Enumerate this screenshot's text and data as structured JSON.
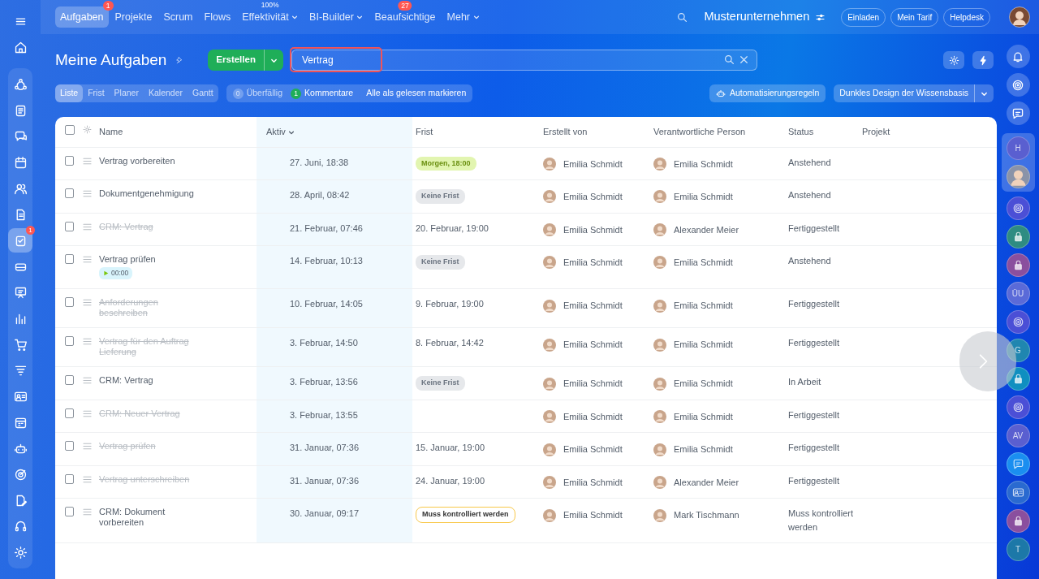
{
  "left_sidebar": {
    "items": [
      {
        "kind": "home",
        "selected": false
      },
      {
        "kind": "flow",
        "selected": false
      },
      {
        "kind": "feed",
        "selected": false
      },
      {
        "kind": "chat",
        "selected": false
      },
      {
        "kind": "calendar",
        "selected": false
      },
      {
        "kind": "people",
        "selected": false
      },
      {
        "kind": "doc",
        "selected": false
      },
      {
        "kind": "tasks",
        "selected": true,
        "badge": "1"
      },
      {
        "kind": "drive",
        "selected": false
      },
      {
        "kind": "board",
        "selected": false
      },
      {
        "kind": "chart",
        "selected": false
      },
      {
        "kind": "cart",
        "selected": false
      },
      {
        "kind": "funnel",
        "selected": false
      },
      {
        "kind": "card",
        "selected": false
      },
      {
        "kind": "planner",
        "selected": false
      },
      {
        "kind": "robot",
        "selected": false
      },
      {
        "kind": "target",
        "selected": false
      },
      {
        "kind": "sign",
        "selected": false
      },
      {
        "kind": "headset",
        "selected": false
      },
      {
        "kind": "settings",
        "selected": false
      }
    ]
  },
  "top_nav": {
    "items": [
      {
        "label": "Aufgaben",
        "selected": true,
        "badge": "1"
      },
      {
        "label": "Projekte",
        "selected": false
      },
      {
        "label": "Scrum",
        "selected": false
      },
      {
        "label": "Flows",
        "selected": false
      },
      {
        "label": "Effektivität",
        "selected": false,
        "caption": "100%",
        "dropdown": true
      },
      {
        "label": "BI-Builder",
        "selected": false,
        "dropdown": true
      },
      {
        "label": "Beaufsichtige",
        "selected": false,
        "badge": "27"
      },
      {
        "label": "Mehr",
        "selected": false,
        "dropdown": true
      }
    ],
    "company": "Musterunternehmen",
    "buttons": [
      "Einladen",
      "Mein Tarif",
      "Helpdesk"
    ]
  },
  "page": {
    "title": "Meine Aufgaben",
    "create_button": "Erstellen",
    "search": {
      "value": "Vertrag",
      "highlighted": true
    }
  },
  "view_tabs": [
    {
      "label": "Liste",
      "selected": true
    },
    {
      "label": "Frist",
      "selected": false
    },
    {
      "label": "Planer",
      "selected": false
    },
    {
      "label": "Kalender",
      "selected": false
    },
    {
      "label": "Gantt",
      "selected": false
    }
  ],
  "counters": [
    {
      "count": "0",
      "label": "Überfällig",
      "active": false
    },
    {
      "count": "1",
      "label": "Kommentare",
      "active": true
    }
  ],
  "mark_all_read": "Alle als gelesen markieren",
  "automation_button": "Automatisierungsregeln",
  "theme_dropdown": "Dunkles Design der Wissensbasis",
  "table": {
    "select_all_checked": false,
    "columns": [
      {
        "label": "Name",
        "sorted": false
      },
      {
        "label": "Aktiv",
        "sorted": true
      },
      {
        "label": "Frist",
        "sorted": false
      },
      {
        "label": "Erstellt von",
        "sorted": false
      },
      {
        "label": "Verantwortliche Person",
        "sorted": false
      },
      {
        "label": "Status",
        "sorted": false
      },
      {
        "label": "Projekt",
        "sorted": false
      }
    ],
    "rows": [
      {
        "checked": false,
        "name": "Vertrag vorbereiten",
        "done": false,
        "active": "27. Juni, 18:38",
        "deadline": {
          "kind": "green",
          "text": "Morgen, 18:00"
        },
        "created_by": "Emilia Schmidt",
        "responsible": "Emilia Schmidt",
        "status": "Anstehend"
      },
      {
        "checked": false,
        "name": "Dokumentgenehmigung",
        "done": false,
        "active": "28. April, 08:42",
        "deadline": {
          "kind": "grey",
          "text": "Keine Frist"
        },
        "created_by": "Emilia Schmidt",
        "responsible": "Emilia Schmidt",
        "status": "Anstehend"
      },
      {
        "checked": false,
        "name": "CRM: Vertrag",
        "done": true,
        "active": "21. Februar, 07:46",
        "deadline": {
          "kind": "plain",
          "text": "20. Februar, 19:00"
        },
        "created_by": "Emilia Schmidt",
        "responsible": "Alexander Meier",
        "status": "Fertiggestellt"
      },
      {
        "checked": false,
        "name": "Vertrag prüfen",
        "done": false,
        "timer": "00:00",
        "active": "14. Februar, 10:13",
        "deadline": {
          "kind": "grey",
          "text": "Keine Frist"
        },
        "created_by": "Emilia Schmidt",
        "responsible": "Emilia Schmidt",
        "status": "Anstehend"
      },
      {
        "checked": false,
        "name": "Anforderungen beschreiben",
        "done": true,
        "active": "10. Februar, 14:05",
        "deadline": {
          "kind": "plain",
          "text": "9. Februar, 19:00"
        },
        "created_by": "Emilia Schmidt",
        "responsible": "Emilia Schmidt",
        "status": "Fertiggestellt"
      },
      {
        "checked": false,
        "name": "Vertrag für den Auftrag Lieferung",
        "done": true,
        "active": "3. Februar, 14:50",
        "deadline": {
          "kind": "plain",
          "text": "8. Februar, 14:42"
        },
        "created_by": "Emilia Schmidt",
        "responsible": "Emilia Schmidt",
        "status": "Fertiggestellt"
      },
      {
        "checked": false,
        "name": "CRM: Vertrag",
        "done": false,
        "active": "3. Februar, 13:56",
        "deadline": {
          "kind": "grey",
          "text": "Keine Frist"
        },
        "created_by": "Emilia Schmidt",
        "responsible": "Emilia Schmidt",
        "status": "In Arbeit"
      },
      {
        "checked": false,
        "name": "CRM: Neuer Vertrag",
        "done": true,
        "active": "3. Februar, 13:55",
        "created_by": "Emilia Schmidt",
        "responsible": "Emilia Schmidt",
        "status": "Fertiggestellt"
      },
      {
        "checked": false,
        "name": "Vertrag prüfen",
        "done": true,
        "active": "31. Januar, 07:36",
        "deadline": {
          "kind": "plain",
          "text": "15. Januar, 19:00"
        },
        "created_by": "Emilia Schmidt",
        "responsible": "Emilia Schmidt",
        "status": "Fertiggestellt"
      },
      {
        "checked": false,
        "name": "Vertrag unterschreiben",
        "done": true,
        "active": "31. Januar, 07:36",
        "deadline": {
          "kind": "plain",
          "text": "24. Januar, 19:00"
        },
        "created_by": "Emilia Schmidt",
        "responsible": "Alexander Meier",
        "status": "Fertiggestellt"
      },
      {
        "checked": false,
        "name": "CRM: Dokument vorbereiten",
        "done": false,
        "active": "30. Januar, 09:17",
        "deadline": {
          "kind": "outline",
          "text": "Muss kontrolliert werden"
        },
        "created_by": "Emilia Schmidt",
        "responsible": "Mark Tischmann",
        "status": "Muss kontrolliert werden"
      }
    ]
  },
  "right_rail": {
    "tools": [
      {
        "kind": "bell"
      },
      {
        "kind": "swirl"
      },
      {
        "kind": "message"
      }
    ],
    "pinned": [
      {
        "kind": "initials",
        "text": "H",
        "color": "#5a5fd0"
      },
      {
        "kind": "avatar",
        "color": "#8a93a8"
      }
    ],
    "contacts": [
      {
        "kind": "swirl",
        "color": "#4b4fd6"
      },
      {
        "kind": "lock",
        "color": "#2e8c82"
      },
      {
        "kind": "lock",
        "color": "#8a4f9e"
      },
      {
        "kind": "initials",
        "text": "ÜU",
        "color": "#5a6ad8"
      },
      {
        "kind": "swirl",
        "color": "#4b4fd6"
      },
      {
        "kind": "initials",
        "text": "G",
        "color": "#1f86b0"
      },
      {
        "kind": "lock",
        "color": "#0f8fc0"
      },
      {
        "kind": "swirl",
        "color": "#4b4fd6"
      },
      {
        "kind": "initials",
        "text": "AV",
        "color": "#5a5fd0"
      },
      {
        "kind": "message",
        "color": "#1a8ef0"
      },
      {
        "kind": "card",
        "color": "#2a6ad0"
      },
      {
        "kind": "lock",
        "color": "#8a4f9e"
      },
      {
        "kind": "initials",
        "text": "T",
        "color": "#1c78a8"
      }
    ]
  }
}
